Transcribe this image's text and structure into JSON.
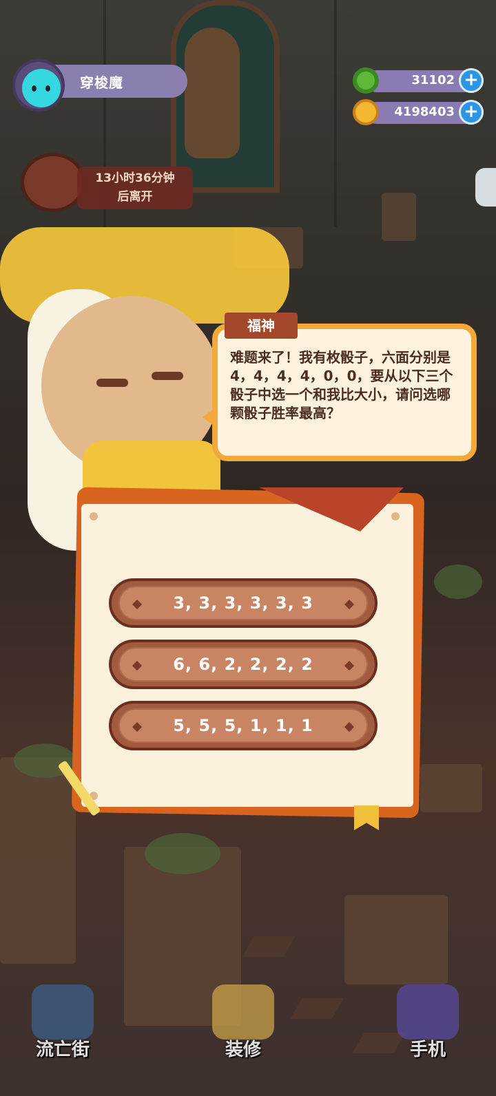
{
  "player": {
    "name": "穿梭魔"
  },
  "currencies": [
    {
      "icon": "green-donut-coin-icon",
      "value": "31102"
    },
    {
      "icon": "gold-planet-coin-icon",
      "value": "4198403"
    }
  ],
  "visitor_timer": {
    "line1": "13小时36分钟",
    "line2": "后离开"
  },
  "dialog": {
    "speaker": "福神",
    "text": "难题来了！我有枚骰子，六面分别是4，4，4，4，0，0，要从以下三个骰子中选一个和我比大小，请问选哪颗骰子胜率最高？"
  },
  "options": [
    {
      "label": "3, 3, 3, 3, 3, 3"
    },
    {
      "label": "6, 6, 2, 2, 2, 2"
    },
    {
      "label": "5, 5, 5, 1, 1, 1"
    }
  ],
  "bottom_nav": [
    {
      "label": "流亡街",
      "icon": "street-portal-icon"
    },
    {
      "label": "装修",
      "icon": "decorate-icon"
    },
    {
      "label": "手机",
      "icon": "phone-icon"
    }
  ],
  "colors": {
    "bubble_border": "#f3a83c",
    "speaker_tag": "#a3472a",
    "option_fill": "#c88463",
    "panel_paper": "#fbf1dc",
    "currency_pill": "#8a7bb2",
    "plus_button": "#2d95e6"
  }
}
